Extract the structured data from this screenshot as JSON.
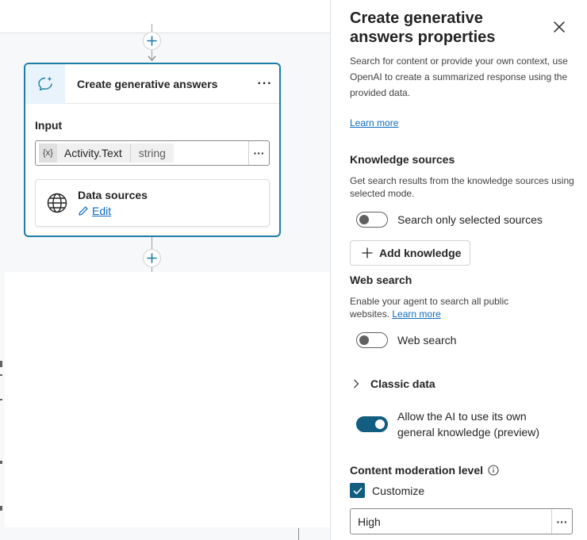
{
  "canvas": {
    "node": {
      "title": "Create generative answers",
      "more_label": "···",
      "icon": "generative-answers-icon",
      "input_label": "Input",
      "input": {
        "variable_icon": "{x}",
        "variable_name": "Activity.Text",
        "variable_type": "string",
        "more_label": "···"
      },
      "data_sources": {
        "title": "Data sources",
        "edit_label": "Edit",
        "icon": "globe-icon"
      }
    }
  },
  "panel": {
    "title": "Create generative answers properties",
    "description": "Search for content or provide your own context, use OpenAI to create a summarized response using the provided data.",
    "learn_more": "Learn more",
    "knowledge": {
      "title": "Knowledge sources",
      "description": "Get search results from the knowledge sources using selected mode.",
      "toggle_label": "Search only selected sources",
      "toggle_on": false,
      "add_button": "Add knowledge"
    },
    "web_search": {
      "title": "Web search",
      "description": "Enable your agent to search all public websites.",
      "learn_more": "Learn more",
      "toggle_label": "Web search",
      "toggle_on": false
    },
    "classic_data": {
      "label": "Classic data"
    },
    "general_knowledge": {
      "toggle_label": "Allow the AI to use its own general knowledge (preview)",
      "toggle_on": true
    },
    "moderation": {
      "title": "Content moderation level",
      "customize_label": "Customize",
      "customize_checked": true,
      "level": "High",
      "more_label": "···"
    }
  },
  "colors": {
    "accent": "#115e80",
    "node_border": "#1e7ea8",
    "link": "#0f6cbd"
  }
}
